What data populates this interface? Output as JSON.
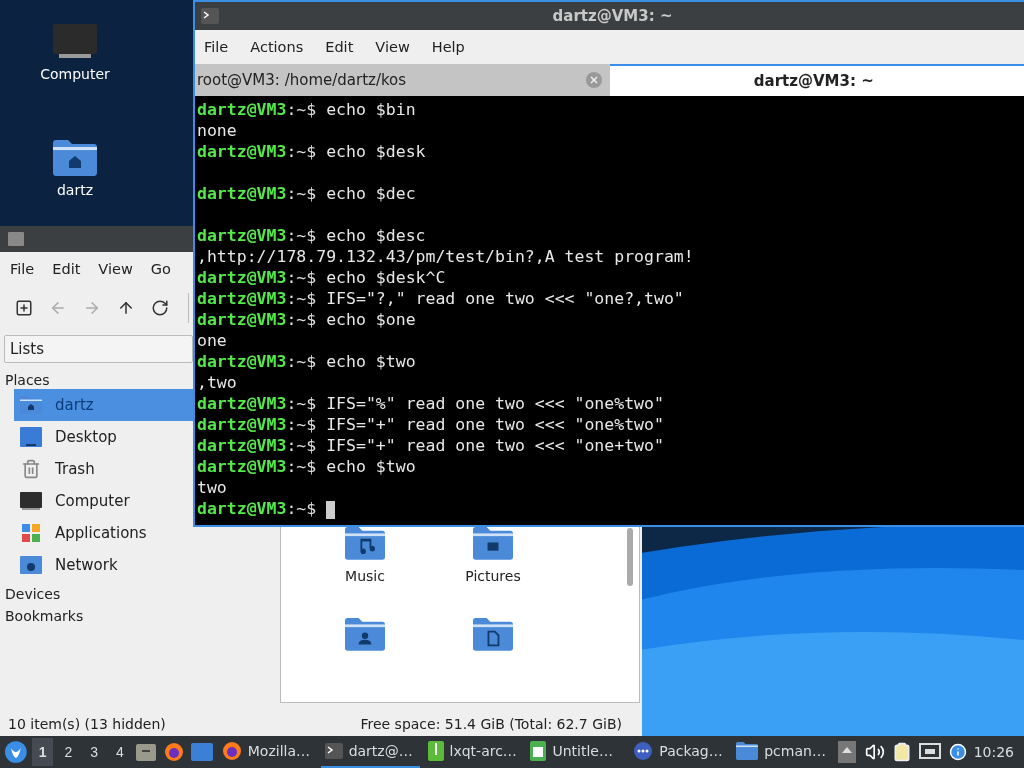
{
  "desktop_icons": [
    {
      "label": "Computer"
    },
    {
      "label": "dartz"
    }
  ],
  "file_manager": {
    "menu": [
      "File",
      "Edit",
      "View",
      "Go"
    ],
    "toolbar": [
      {
        "disabled": false
      },
      {
        "disabled": true
      },
      {
        "disabled": true
      },
      {
        "disabled": false
      },
      {
        "disabled": false
      }
    ],
    "side_view": "Lists",
    "sections": [
      {
        "title": "Places",
        "items": [
          {
            "label": "dartz",
            "selected": true
          },
          {
            "label": "Desktop",
            "selected": false
          },
          {
            "label": "Trash",
            "selected": false
          },
          {
            "label": "Computer",
            "selected": false
          },
          {
            "label": "Applications",
            "selected": false
          },
          {
            "label": "Network",
            "selected": false
          }
        ]
      },
      {
        "title": "Devices"
      },
      {
        "title": "Bookmarks"
      }
    ],
    "files": [
      {
        "name": "Music",
        "kind": "music"
      },
      {
        "name": "Pictures",
        "kind": "pictures"
      },
      {
        "kind": "user"
      },
      {
        "kind": "document"
      }
    ],
    "status_left": "10 item(s) (13 hidden)",
    "status_right": "Free space: 51.4 GiB (Total: 62.7 GiB)"
  },
  "terminal": {
    "title": "dartz@VM3: ~",
    "menu": [
      "File",
      "Actions",
      "Edit",
      "View",
      "Help"
    ],
    "tabs": [
      {
        "label": "root@VM3: /home/dartz/kos",
        "selected": false
      },
      {
        "label": "dartz@VM3: ~",
        "selected": true
      }
    ],
    "lines": [
      {
        "kind": "prompt",
        "user": "dartz@VM3",
        "suffix": ":~$",
        "command": "echo $bin"
      },
      {
        "kind": "output",
        "text": "none"
      },
      {
        "kind": "prompt",
        "user": "dartz@VM3",
        "suffix": ":~$",
        "command": "echo $desk"
      },
      {
        "kind": "blank"
      },
      {
        "kind": "prompt",
        "user": "dartz@VM3",
        "suffix": ":~$",
        "command": "echo $dec"
      },
      {
        "kind": "blank"
      },
      {
        "kind": "prompt",
        "user": "dartz@VM3",
        "suffix": ":~$",
        "command": "echo $desc"
      },
      {
        "kind": "output",
        "text": ",http://178.79.132.43/pm/test/bin?,A test program!"
      },
      {
        "kind": "prompt",
        "user": "dartz@VM3",
        "suffix": ":~$",
        "command": "echo $desk^C"
      },
      {
        "kind": "prompt",
        "user": "dartz@VM3",
        "suffix": ":~$",
        "command": "IFS=\"?,\" read one two <<< \"one?,two\""
      },
      {
        "kind": "prompt",
        "user": "dartz@VM3",
        "suffix": ":~$",
        "command": "echo $one"
      },
      {
        "kind": "output",
        "text": "one"
      },
      {
        "kind": "prompt",
        "user": "dartz@VM3",
        "suffix": ":~$",
        "command": "echo $two"
      },
      {
        "kind": "output",
        "text": ",two"
      },
      {
        "kind": "prompt",
        "user": "dartz@VM3",
        "suffix": ":~$",
        "command": "IFS=\"%\" read one two <<< \"one%two\""
      },
      {
        "kind": "prompt",
        "user": "dartz@VM3",
        "suffix": ":~$",
        "command": "IFS=\"+\" read one two <<< \"one%two\""
      },
      {
        "kind": "prompt",
        "user": "dartz@VM3",
        "suffix": ":~$",
        "command": "IFS=\"+\" read one two <<< \"one+two\""
      },
      {
        "kind": "prompt",
        "user": "dartz@VM3",
        "suffix": ":~$",
        "command": "echo $two"
      },
      {
        "kind": "output",
        "text": "two"
      },
      {
        "kind": "cursor",
        "user": "dartz@VM3",
        "suffix": ":~$"
      }
    ]
  },
  "taskbar": {
    "desktops": [
      {
        "label": "1",
        "selected": true
      },
      {
        "label": "2",
        "selected": false
      },
      {
        "label": "3",
        "selected": false
      },
      {
        "label": "4",
        "selected": false
      }
    ],
    "tasks": [
      {
        "label": "Mozilla…",
        "selected": false
      },
      {
        "label": "dartz@…",
        "selected": true
      },
      {
        "label": "lxqt-arc…",
        "selected": false
      },
      {
        "label": "Untitle…",
        "selected": false
      },
      {
        "label": "Packag…",
        "selected": false
      },
      {
        "label": "pcman…",
        "selected": false
      }
    ],
    "clock": "10:26"
  }
}
